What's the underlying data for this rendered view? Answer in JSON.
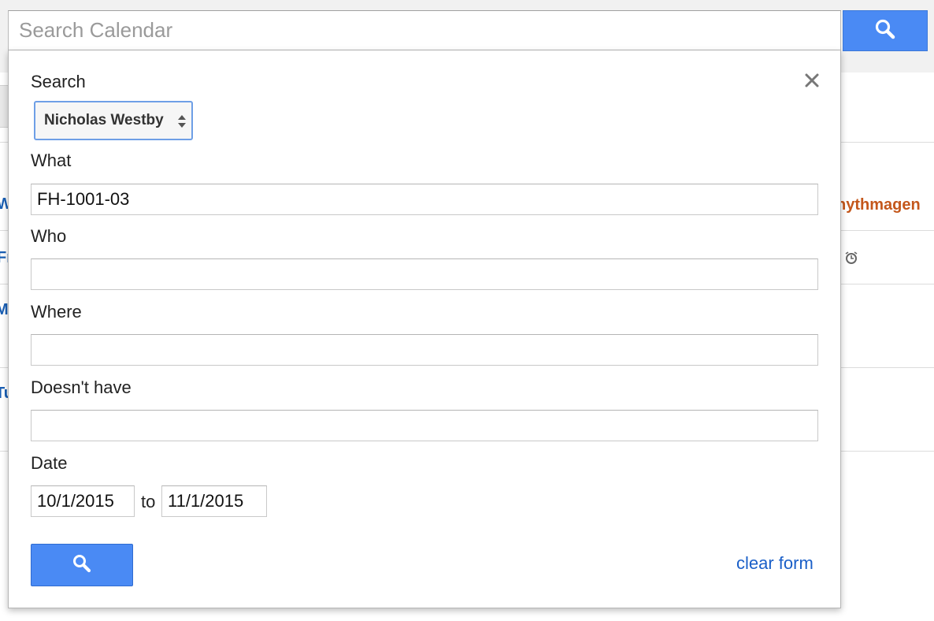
{
  "search_bar": {
    "placeholder": "Search Calendar",
    "button_icon": "search-icon"
  },
  "popup": {
    "close_icon": "close-icon",
    "search_label": "Search",
    "calendar_select": {
      "selected": "Nicholas Westby",
      "icon": "updown-arrows-icon"
    },
    "what": {
      "label": "What",
      "value": "FH-1001-03"
    },
    "who": {
      "label": "Who",
      "value": ""
    },
    "where": {
      "label": "Where",
      "value": ""
    },
    "doesnt_have": {
      "label": "Doesn't have",
      "value": ""
    },
    "date": {
      "label": "Date",
      "from": "10/1/2015",
      "to_label": "to",
      "to": "11/1/2015"
    },
    "submit_icon": "search-icon",
    "clear_label": "clear form"
  },
  "background": {
    "partial_event_text": "nythmagen",
    "row_letters": [
      "W",
      "Fr",
      "M",
      "Tu"
    ],
    "alarm_icon": "alarm-clock-icon"
  },
  "colors": {
    "accent_blue": "#4a8af4",
    "link_blue": "#1a5fc8",
    "event_orange": "#c4571b"
  }
}
